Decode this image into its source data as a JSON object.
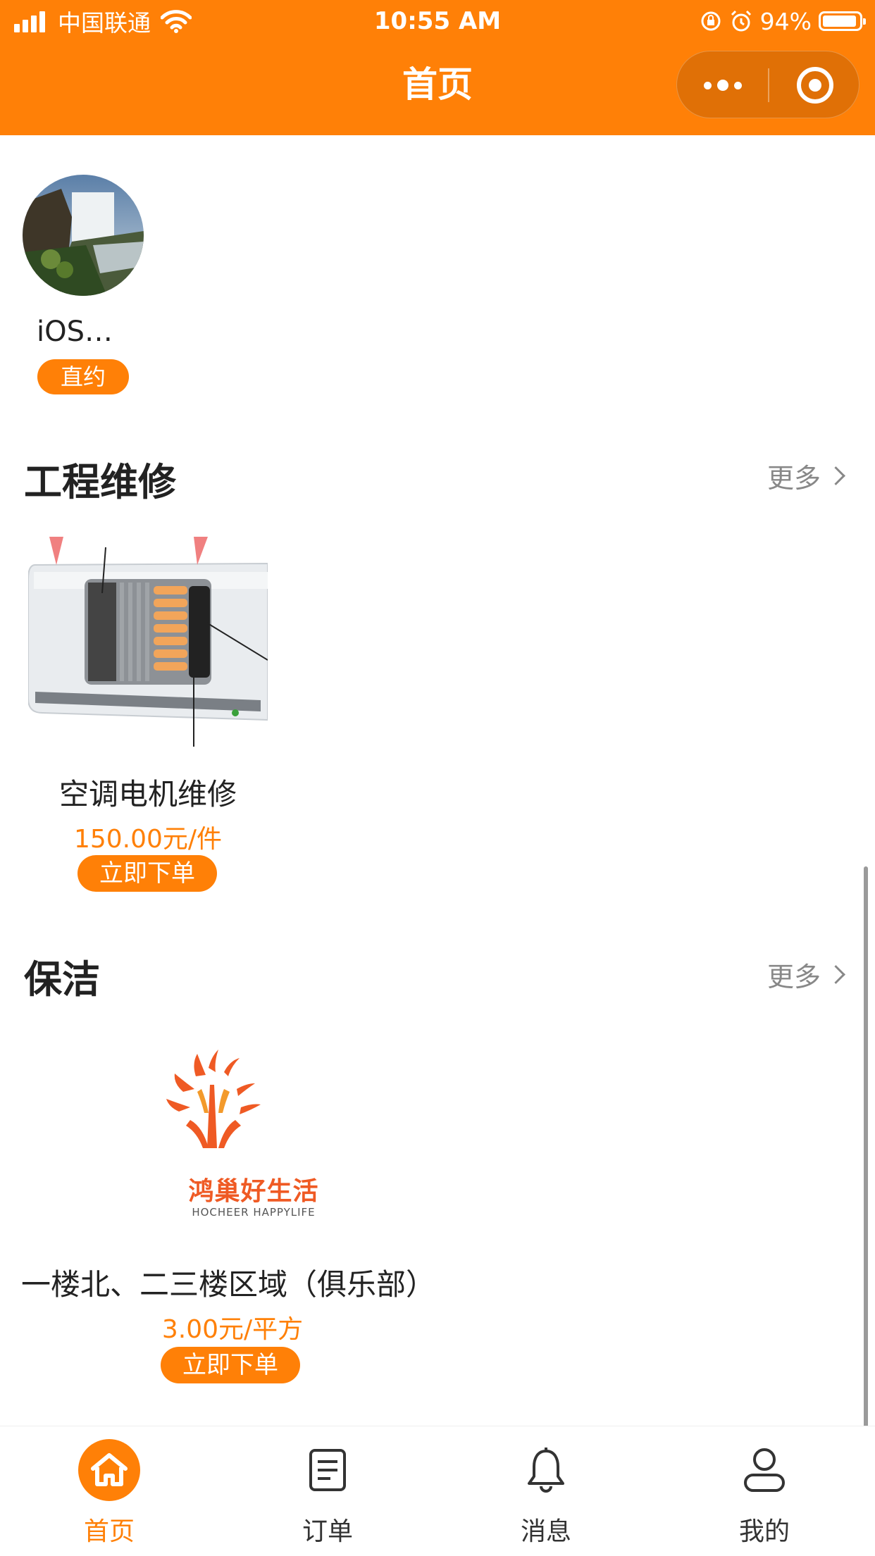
{
  "status_bar": {
    "carrier": "中国联通",
    "time": "10:55 AM",
    "battery": "94%",
    "battery_level": 0.94,
    "icons": [
      "signal-icon",
      "wifi-icon",
      "orientation-lock-icon",
      "alarm-icon",
      "battery-icon"
    ]
  },
  "nav": {
    "title": "首页",
    "capsule_icons": [
      "more-dots-icon",
      "close-target-icon"
    ]
  },
  "provider": {
    "name": "iOS…",
    "badge": "直约"
  },
  "sections": [
    {
      "title": "工程维修",
      "more": "更多",
      "items": [
        {
          "name": "空调电机维修",
          "price": "150.00元/件",
          "button": "立即下单"
        }
      ]
    },
    {
      "title": "保洁",
      "more": "更多",
      "items": [
        {
          "name": "一楼北、二三楼区域（俱乐部）",
          "price": "3.00元/平方",
          "button": "立即下单",
          "logo_text_cn": "鸿巢好生活",
          "logo_text_en": "HOCHEER HAPPYLIFE"
        }
      ]
    }
  ],
  "tabbar": [
    {
      "label": "首页",
      "icon": "home-icon",
      "active": true
    },
    {
      "label": "订单",
      "icon": "order-icon",
      "active": false
    },
    {
      "label": "消息",
      "icon": "bell-icon",
      "active": false
    },
    {
      "label": "我的",
      "icon": "user-icon",
      "active": false
    }
  ],
  "colors": {
    "accent": "#ff8007",
    "text": "#222222",
    "muted": "#888888"
  }
}
